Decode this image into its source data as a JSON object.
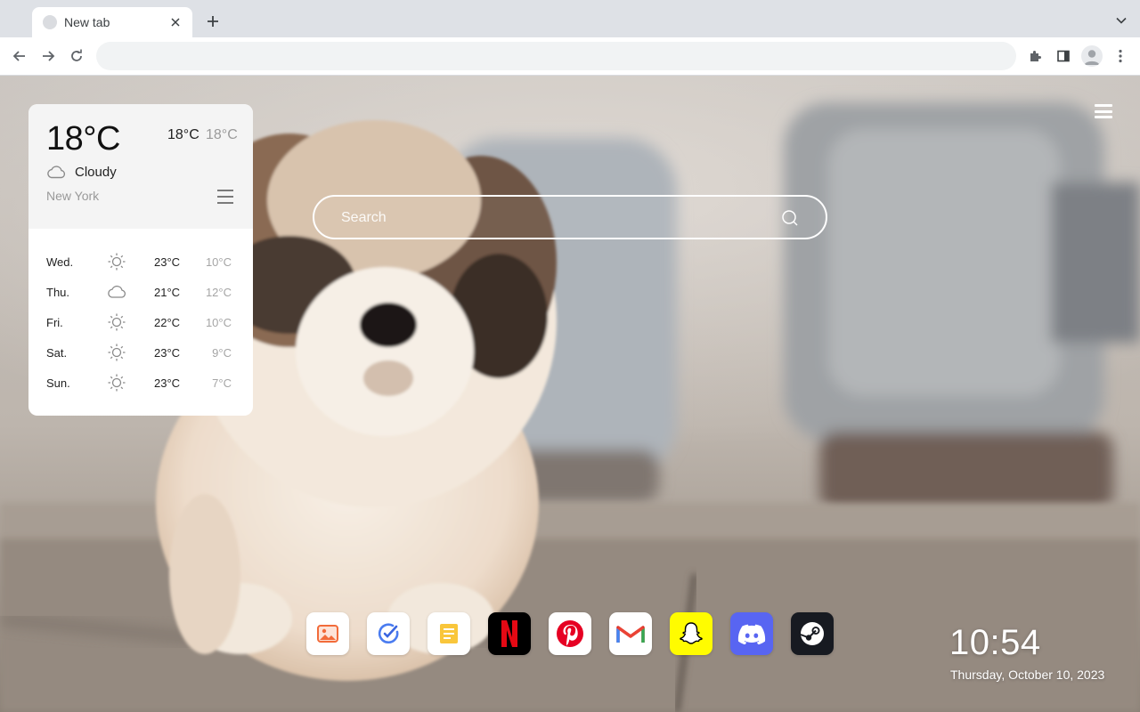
{
  "browser": {
    "tab_title": "New tab",
    "address_value": ""
  },
  "weather": {
    "current_temp": "18°C",
    "high": "18°C",
    "low": "18°C",
    "condition": "Cloudy",
    "condition_icon": "cloud-icon",
    "city": "New York",
    "forecast": [
      {
        "day": "Wed.",
        "icon": "sun-icon",
        "high": "23°C",
        "low": "10°C"
      },
      {
        "day": "Thu.",
        "icon": "cloud-icon",
        "high": "21°C",
        "low": "12°C"
      },
      {
        "day": "Fri.",
        "icon": "sun-icon",
        "high": "22°C",
        "low": "10°C"
      },
      {
        "day": "Sat.",
        "icon": "sun-icon",
        "high": "23°C",
        "low": "9°C"
      },
      {
        "day": "Sun.",
        "icon": "sun-icon",
        "high": "23°C",
        "low": "7°C"
      }
    ]
  },
  "search": {
    "placeholder": "Search"
  },
  "shortcuts": [
    {
      "name": "photos",
      "icon": "photos-icon",
      "color": "#ffffff"
    },
    {
      "name": "tasks",
      "icon": "check-icon",
      "color": "#ffffff"
    },
    {
      "name": "notes",
      "icon": "notes-icon",
      "color": "#ffffff"
    },
    {
      "name": "netflix",
      "icon": "netflix-icon",
      "color": "#000000"
    },
    {
      "name": "pinterest",
      "icon": "pinterest-icon",
      "color": "#ffffff"
    },
    {
      "name": "gmail",
      "icon": "gmail-icon",
      "color": "#ffffff"
    },
    {
      "name": "snapchat",
      "icon": "snapchat-icon",
      "color": "#fffc00"
    },
    {
      "name": "discord",
      "icon": "discord-icon",
      "color": "#5865f2"
    },
    {
      "name": "steam",
      "icon": "steam-icon",
      "color": "#171a21"
    }
  ],
  "clock": {
    "time": "10:54",
    "date": "Thursday, October 10, 2023"
  }
}
